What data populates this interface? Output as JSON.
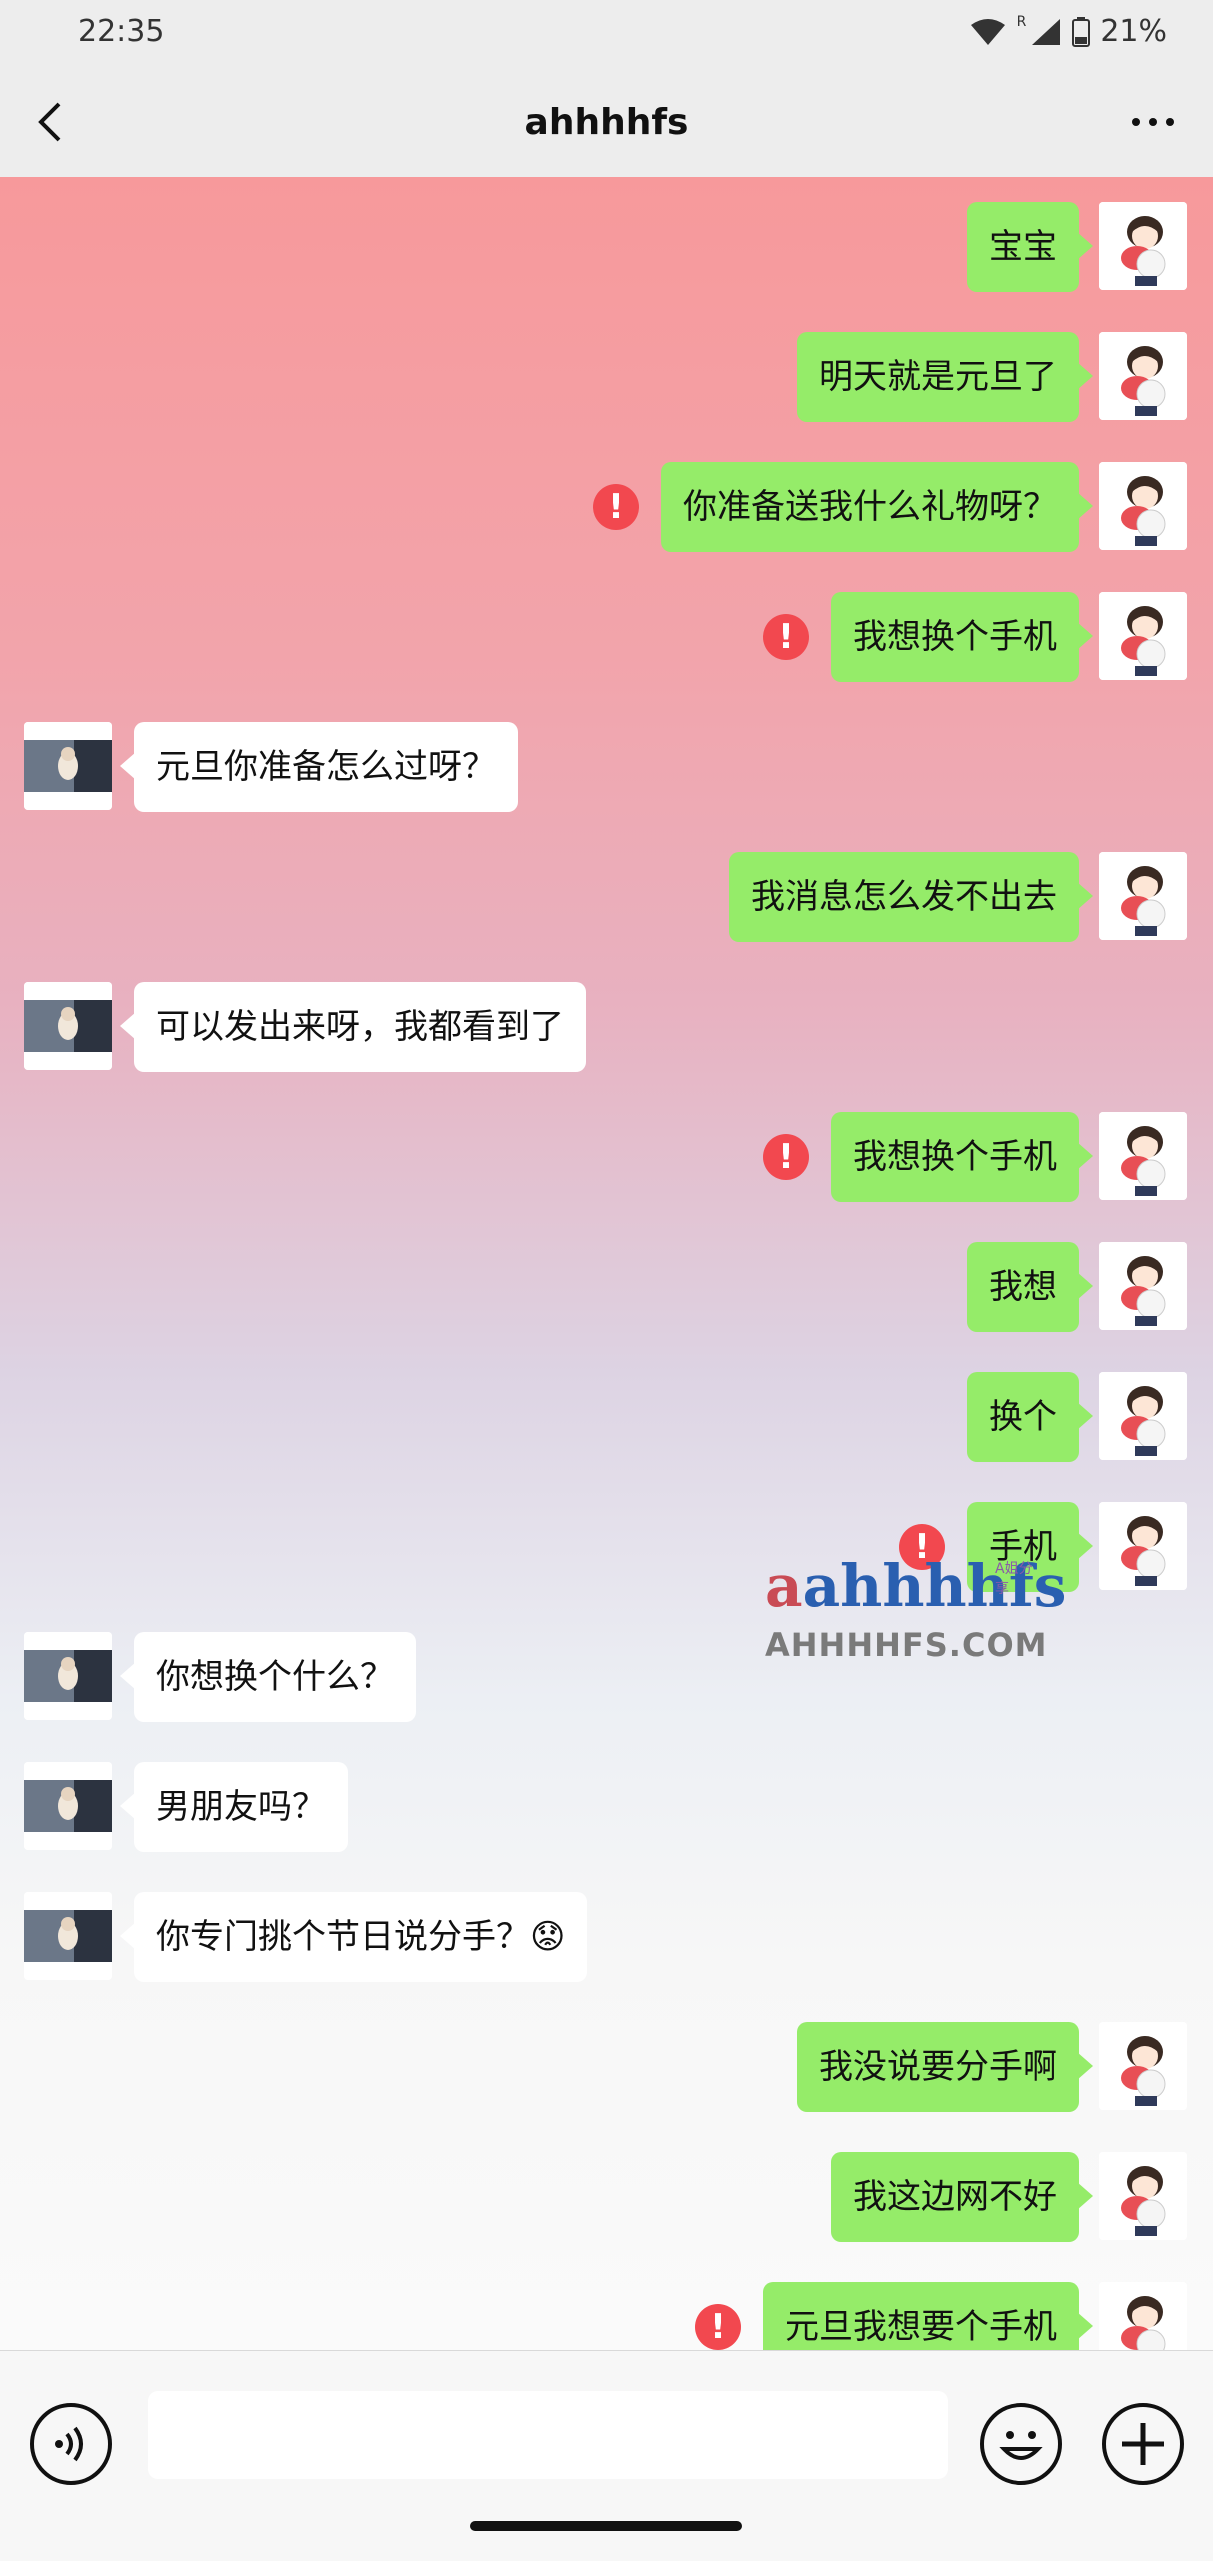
{
  "status_bar": {
    "time": "22:35",
    "signal_label": "R",
    "battery": "21%"
  },
  "header": {
    "title": "ahhhhfs",
    "back_icon": "chevron-left-icon",
    "more_icon": "more-horizontal-icon"
  },
  "messages": [
    {
      "side": "me",
      "text": "宝宝",
      "error": false
    },
    {
      "side": "me",
      "text": "明天就是元旦了",
      "error": false
    },
    {
      "side": "me",
      "text": "你准备送我什么礼物呀？",
      "error": true
    },
    {
      "side": "me",
      "text": "我想换个手机",
      "error": true
    },
    {
      "side": "other",
      "text": "元旦你准备怎么过呀？",
      "error": false
    },
    {
      "side": "me",
      "text": "我消息怎么发不出去",
      "error": false
    },
    {
      "side": "other",
      "text": "可以发出来呀，我都看到了",
      "error": false
    },
    {
      "side": "me",
      "text": "我想换个手机",
      "error": true
    },
    {
      "side": "me",
      "text": "我想",
      "error": false
    },
    {
      "side": "me",
      "text": "换个",
      "error": false
    },
    {
      "side": "me",
      "text": "手机",
      "error": true
    },
    {
      "side": "other",
      "text": "你想换个什么？",
      "error": false
    },
    {
      "side": "other",
      "text": "男朋友吗？",
      "error": false
    },
    {
      "side": "other",
      "text": "你专门挑个节日说分手？😟",
      "error": false
    },
    {
      "side": "me",
      "text": "我没说要分手啊",
      "error": false
    },
    {
      "side": "me",
      "text": "我这边网不好",
      "error": false
    },
    {
      "side": "me",
      "text": "元旦我想要个手机",
      "error": true
    }
  ],
  "watermark": {
    "logo": "ahhhhfs",
    "site": "AHHHHFS.COM",
    "tag": "A姐分享"
  },
  "input_bar": {
    "voice_icon": "voice-icon",
    "emoji_icon": "emoji-icon",
    "plus_icon": "plus-icon",
    "placeholder": ""
  },
  "colors": {
    "my_bubble": "#95ec69",
    "other_bubble": "#ffffff",
    "error": "#f2484f"
  }
}
